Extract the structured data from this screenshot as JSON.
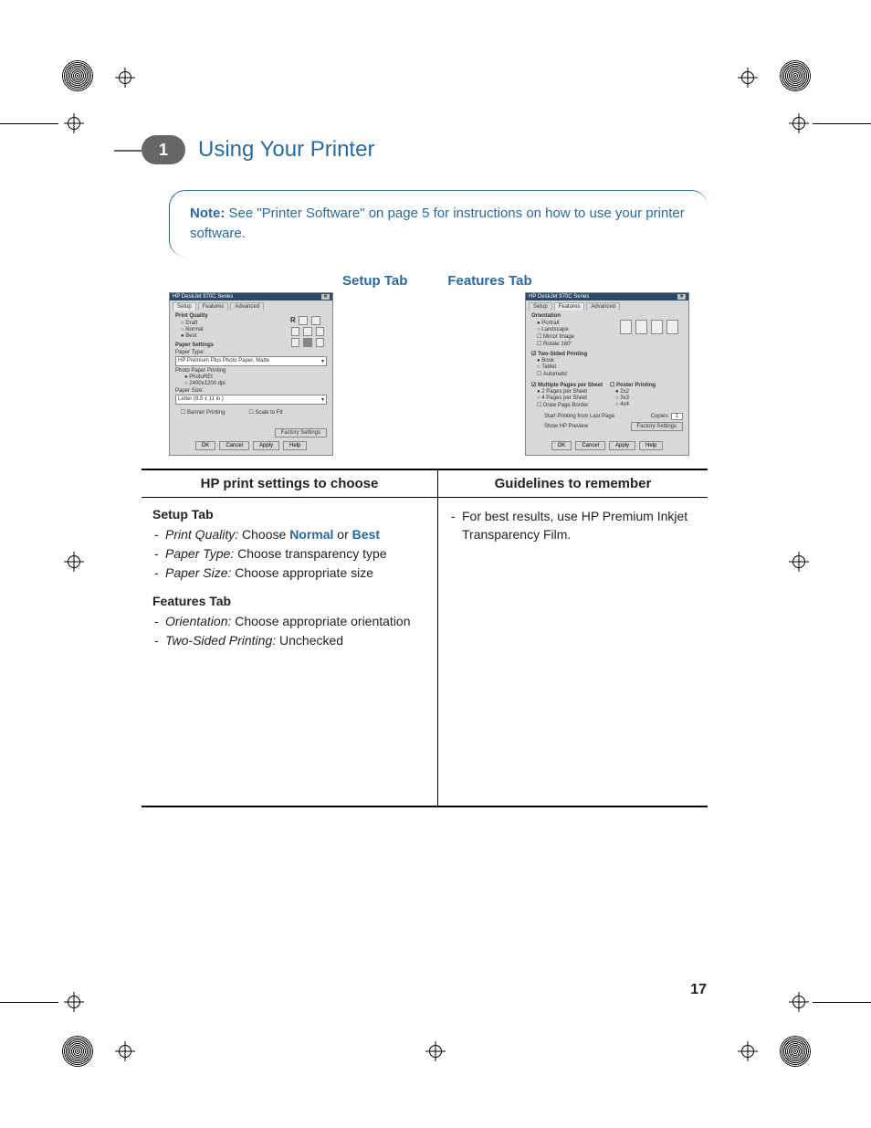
{
  "chapter": {
    "number": "1",
    "title": "Using Your Printer"
  },
  "note": {
    "label": "Note:",
    "text": " See \"Printer Software\" on page 5 for instructions on how to use your printer software."
  },
  "tab_labels": {
    "setup": "Setup Tab",
    "features": "Features Tab"
  },
  "setup_dialog": {
    "title": "HP DeskJet 970C Series",
    "tabs": [
      "Setup",
      "Features",
      "Advanced"
    ],
    "print_quality_label": "Print Quality",
    "pq_draft": "Draft",
    "pq_normal": "Normal",
    "pq_best": "Best",
    "paper_settings_label": "Paper Settings",
    "paper_type_label": "Paper Type:",
    "paper_type_value": "HP Premium Plus Photo Paper, Matte",
    "photo_paper_label": "Photo Paper Printing",
    "photo_ret": "PhotoREt",
    "photo_dpi": "2400x1200 dpi",
    "paper_size_label": "Paper Size:",
    "paper_size_value": "Letter (8.5 x 11 in.)",
    "banner": "Banner Printing",
    "scale": "Scale to Fit",
    "factory": "Factory Settings",
    "btn_ok": "OK",
    "btn_cancel": "Cancel",
    "btn_apply": "Apply",
    "btn_help": "Help"
  },
  "features_dialog": {
    "title": "HP DeskJet 970C Series",
    "tabs": [
      "Setup",
      "Features",
      "Advanced"
    ],
    "orientation_label": "Orientation",
    "o_portrait": "Portrait",
    "o_landscape": "Landscape",
    "o_mirror": "Mirror Image",
    "o_rotate": "Rotate 180°",
    "two_sided_label": "Two-Sided Printing",
    "ts_book": "Book",
    "ts_tablet": "Tablet",
    "ts_auto": "Automatic",
    "multi_label": "Multiple Pages per Sheet",
    "mp_2": "2 Pages per Sheet",
    "mp_4": "4 Pages per Sheet",
    "mp_border": "Draw Page Border",
    "poster_label": "Poster Printing",
    "p_2": "2x2",
    "p_3": "3x3",
    "p_4": "4x4",
    "start_last": "Start Printing from Last Page",
    "copies_label": "Copies:",
    "copies_value": "1",
    "preview": "Show HP Preview",
    "factory": "Factory Settings",
    "btn_ok": "OK",
    "btn_cancel": "Cancel",
    "btn_apply": "Apply",
    "btn_help": "Help"
  },
  "table": {
    "h1": "HP print settings to choose",
    "h2": "Guidelines to remember",
    "left": {
      "setup_heading": "Setup Tab",
      "pq_label": "Print Quality:",
      "pq_text": " Choose ",
      "pq_normal": "Normal",
      "pq_or": " or ",
      "pq_best": "Best",
      "pt_label": "Paper Type:",
      "pt_text": " Choose transparency type",
      "ps_label": "Paper Size:",
      "ps_text": " Choose appropriate size",
      "features_heading": "Features Tab",
      "or_label": "Orientation:",
      "or_text": " Choose appropriate orientation",
      "ts_label": "Two-Sided Printing:",
      "ts_text": " Unchecked"
    },
    "right": {
      "line1": "For best results, use HP Premium Inkjet Transparency Film."
    }
  },
  "page_number": "17"
}
